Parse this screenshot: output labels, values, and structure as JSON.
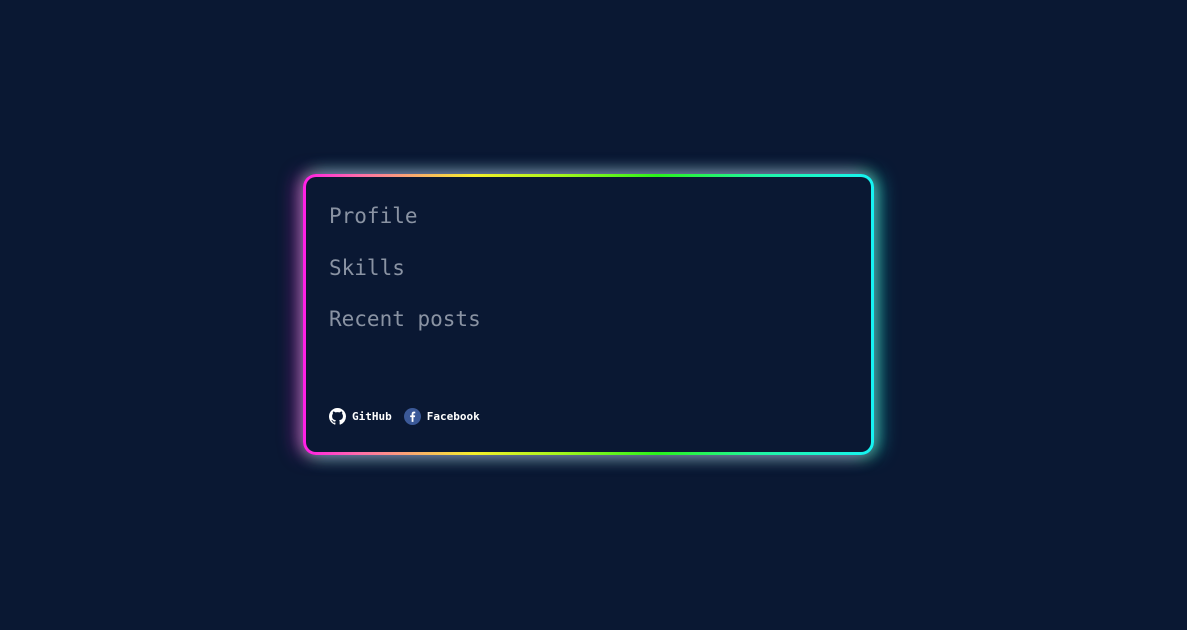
{
  "nav": {
    "items": [
      {
        "label": "Profile"
      },
      {
        "label": "Skills"
      },
      {
        "label": "Recent posts"
      }
    ]
  },
  "social": {
    "github": {
      "label": "GitHub",
      "icon": "github-icon"
    },
    "facebook": {
      "label": "Facebook",
      "icon": "facebook-icon"
    }
  },
  "colors": {
    "background": "#0a1833",
    "nav_text": "#8a93a3",
    "border_start": "#ff1ee6",
    "border_mid": "#2bf21c",
    "border_end": "#16f3f3",
    "facebook_blue": "#3b5998"
  }
}
